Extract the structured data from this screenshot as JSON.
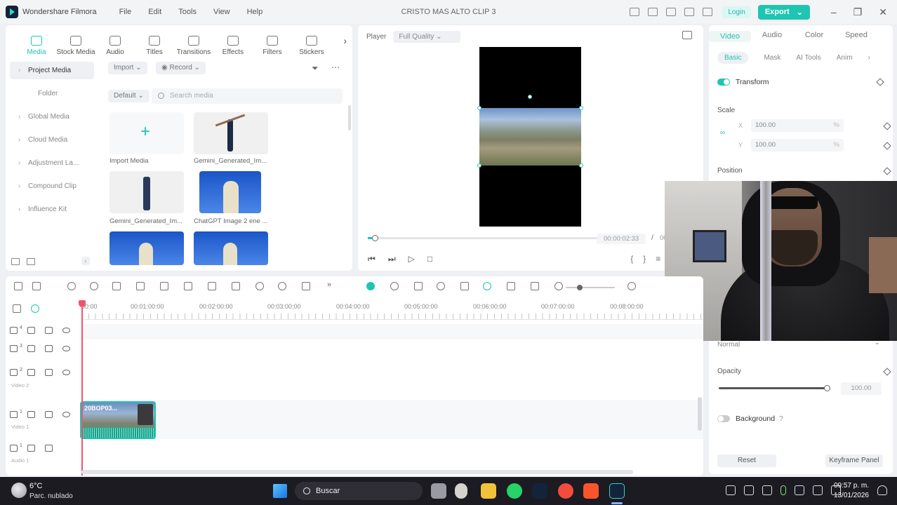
{
  "app": {
    "name": "Wondershare Filmora",
    "window_title": "CRISTO MAS ALTO CLIP 3",
    "menu": [
      "File",
      "Edit",
      "Tools",
      "View",
      "Help"
    ],
    "login_label": "Login",
    "export_label": "Export"
  },
  "media_panel": {
    "tabs": [
      "Media",
      "Stock Media",
      "Audio",
      "Titles",
      "Transitions",
      "Effects",
      "Filters",
      "Stickers"
    ],
    "sidebar": [
      "Project Media",
      "Folder",
      "Global Media",
      "Cloud Media",
      "Adjustment La...",
      "Compound Clip",
      "Influence Kit"
    ],
    "import_label": "Import",
    "record_label": "Record",
    "sort_label": "Default",
    "search_placeholder": "Search media",
    "items": [
      {
        "label": "Import Media"
      },
      {
        "label": "Gemini_Generated_Im..."
      },
      {
        "label": "Gemini_Generated_Im..."
      },
      {
        "label": "ChatGPT Image 2 ene ..."
      },
      {
        "label": ""
      },
      {
        "label": ""
      }
    ]
  },
  "player": {
    "label": "Player",
    "quality": "Full Quality",
    "timecode": "00:00:02:33",
    "separator": "/",
    "total": "00",
    "progress": 0.03
  },
  "properties": {
    "tabs": [
      "Video",
      "Audio",
      "Color",
      "Speed"
    ],
    "sub_tabs": [
      "Basic",
      "Mask",
      "AI Tools",
      "Anim"
    ],
    "transform_label": "Transform",
    "scale_label": "Scale",
    "scale_x_axis": "X",
    "scale_y_axis": "Y",
    "scale_x": "100.00",
    "scale_y": "100.00",
    "percent_unit": "%",
    "position_label": "Position",
    "blend_mode": "Normal",
    "opacity_label": "Opacity",
    "opacity_value": "100.00",
    "background_label": "Background",
    "reset_label": "Reset",
    "keyframe_label": "Keyframe Panel"
  },
  "timeline": {
    "ruler": [
      "00:00",
      "00:01:00:00",
      "00:02:00:00",
      "00:03:00:00",
      "00:04:00:00",
      "00:05:00:00",
      "00:06:00:00",
      "00:07:00:00",
      "00:08:00:00"
    ],
    "tracks": [
      {
        "num": "4",
        "name": ""
      },
      {
        "num": "3",
        "name": ""
      },
      {
        "num": "2",
        "name": "Video 2"
      },
      {
        "num": "1",
        "name": "Video 1"
      },
      {
        "num": "1",
        "name": "Audio 1"
      }
    ],
    "clip_title": "20BOP03..."
  },
  "taskbar": {
    "temperature": "6°C",
    "weather": "Parc. nublado",
    "search": "Buscar",
    "time": "09:57 p. m.",
    "date": "13/01/2026"
  },
  "colors": {
    "accent": "#1fc5b1",
    "playhead": "#f2546d",
    "taskbar": "#1c1b22"
  }
}
